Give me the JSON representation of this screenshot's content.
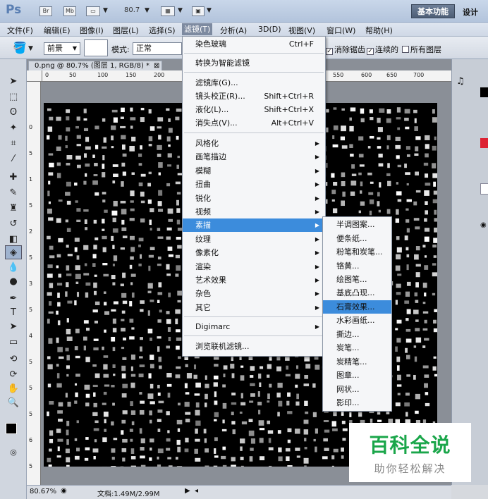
{
  "app": {
    "logo": "Ps",
    "bridge": "Br",
    "minibridge": "Mb",
    "zoom": "80.7",
    "workspace_basic": "基本功能",
    "workspace_design": "设计"
  },
  "menubar": [
    "文件(F)",
    "编辑(E)",
    "图像(I)",
    "图层(L)",
    "选择(S)",
    "滤镜(T)",
    "分析(A)",
    "3D(D)",
    "视图(V)",
    "窗口(W)",
    "帮助(H)"
  ],
  "options": {
    "foreground": "前景",
    "mode_label": "模式:",
    "mode_value": "正常",
    "antialias": "消除锯齿",
    "contiguous": "连续的",
    "all_layers": "所有图层",
    "antialias_checked": true,
    "contiguous_checked": true,
    "all_layers_checked": false
  },
  "document": {
    "tab_title": "0.png @ 80.7% (图层 1, RGB/8) *"
  },
  "ruler": {
    "h": [
      "0",
      "50",
      "100",
      "150",
      "200",
      "550",
      "600",
      "650",
      "700"
    ],
    "v": [
      "0",
      "5",
      "1",
      "5",
      "2",
      "5",
      "3",
      "5",
      "4",
      "5",
      "5",
      "5",
      "6",
      "5",
      "7"
    ]
  },
  "filter_menu": {
    "last_filter": "染色玻璃",
    "last_filter_shortcut": "Ctrl+F",
    "smart": "转换为智能滤镜",
    "gallery": "滤镜库(G)...",
    "lens": "镜头校正(R)...",
    "lens_shortcut": "Shift+Ctrl+R",
    "liquify": "液化(L)...",
    "liquify_shortcut": "Shift+Ctrl+X",
    "vanish": "消失点(V)...",
    "vanish_shortcut": "Alt+Ctrl+V",
    "groups": [
      "风格化",
      "画笔描边",
      "模糊",
      "扭曲",
      "锐化",
      "视频",
      "素描",
      "纹理",
      "像素化",
      "渲染",
      "艺术效果",
      "杂色",
      "其它"
    ],
    "digimarc": "Digimarc",
    "browse": "浏览联机滤镜..."
  },
  "sketch_menu": [
    "半调图案...",
    "便条纸...",
    "粉笔和炭笔...",
    "铬黄...",
    "绘图笔...",
    "基底凸现...",
    "石膏效果...",
    "水彩画纸...",
    "撕边...",
    "炭笔...",
    "炭精笔...",
    "图章...",
    "网状...",
    "影印..."
  ],
  "status": {
    "zoom": "80.67%",
    "doc": "文档:1.49M/2.99M"
  },
  "watermark": {
    "title": "百科全说",
    "subtitle": "助你轻松解决"
  },
  "colors": {
    "highlight": "#3c8cdc",
    "watermark_green": "#1aa64a"
  }
}
